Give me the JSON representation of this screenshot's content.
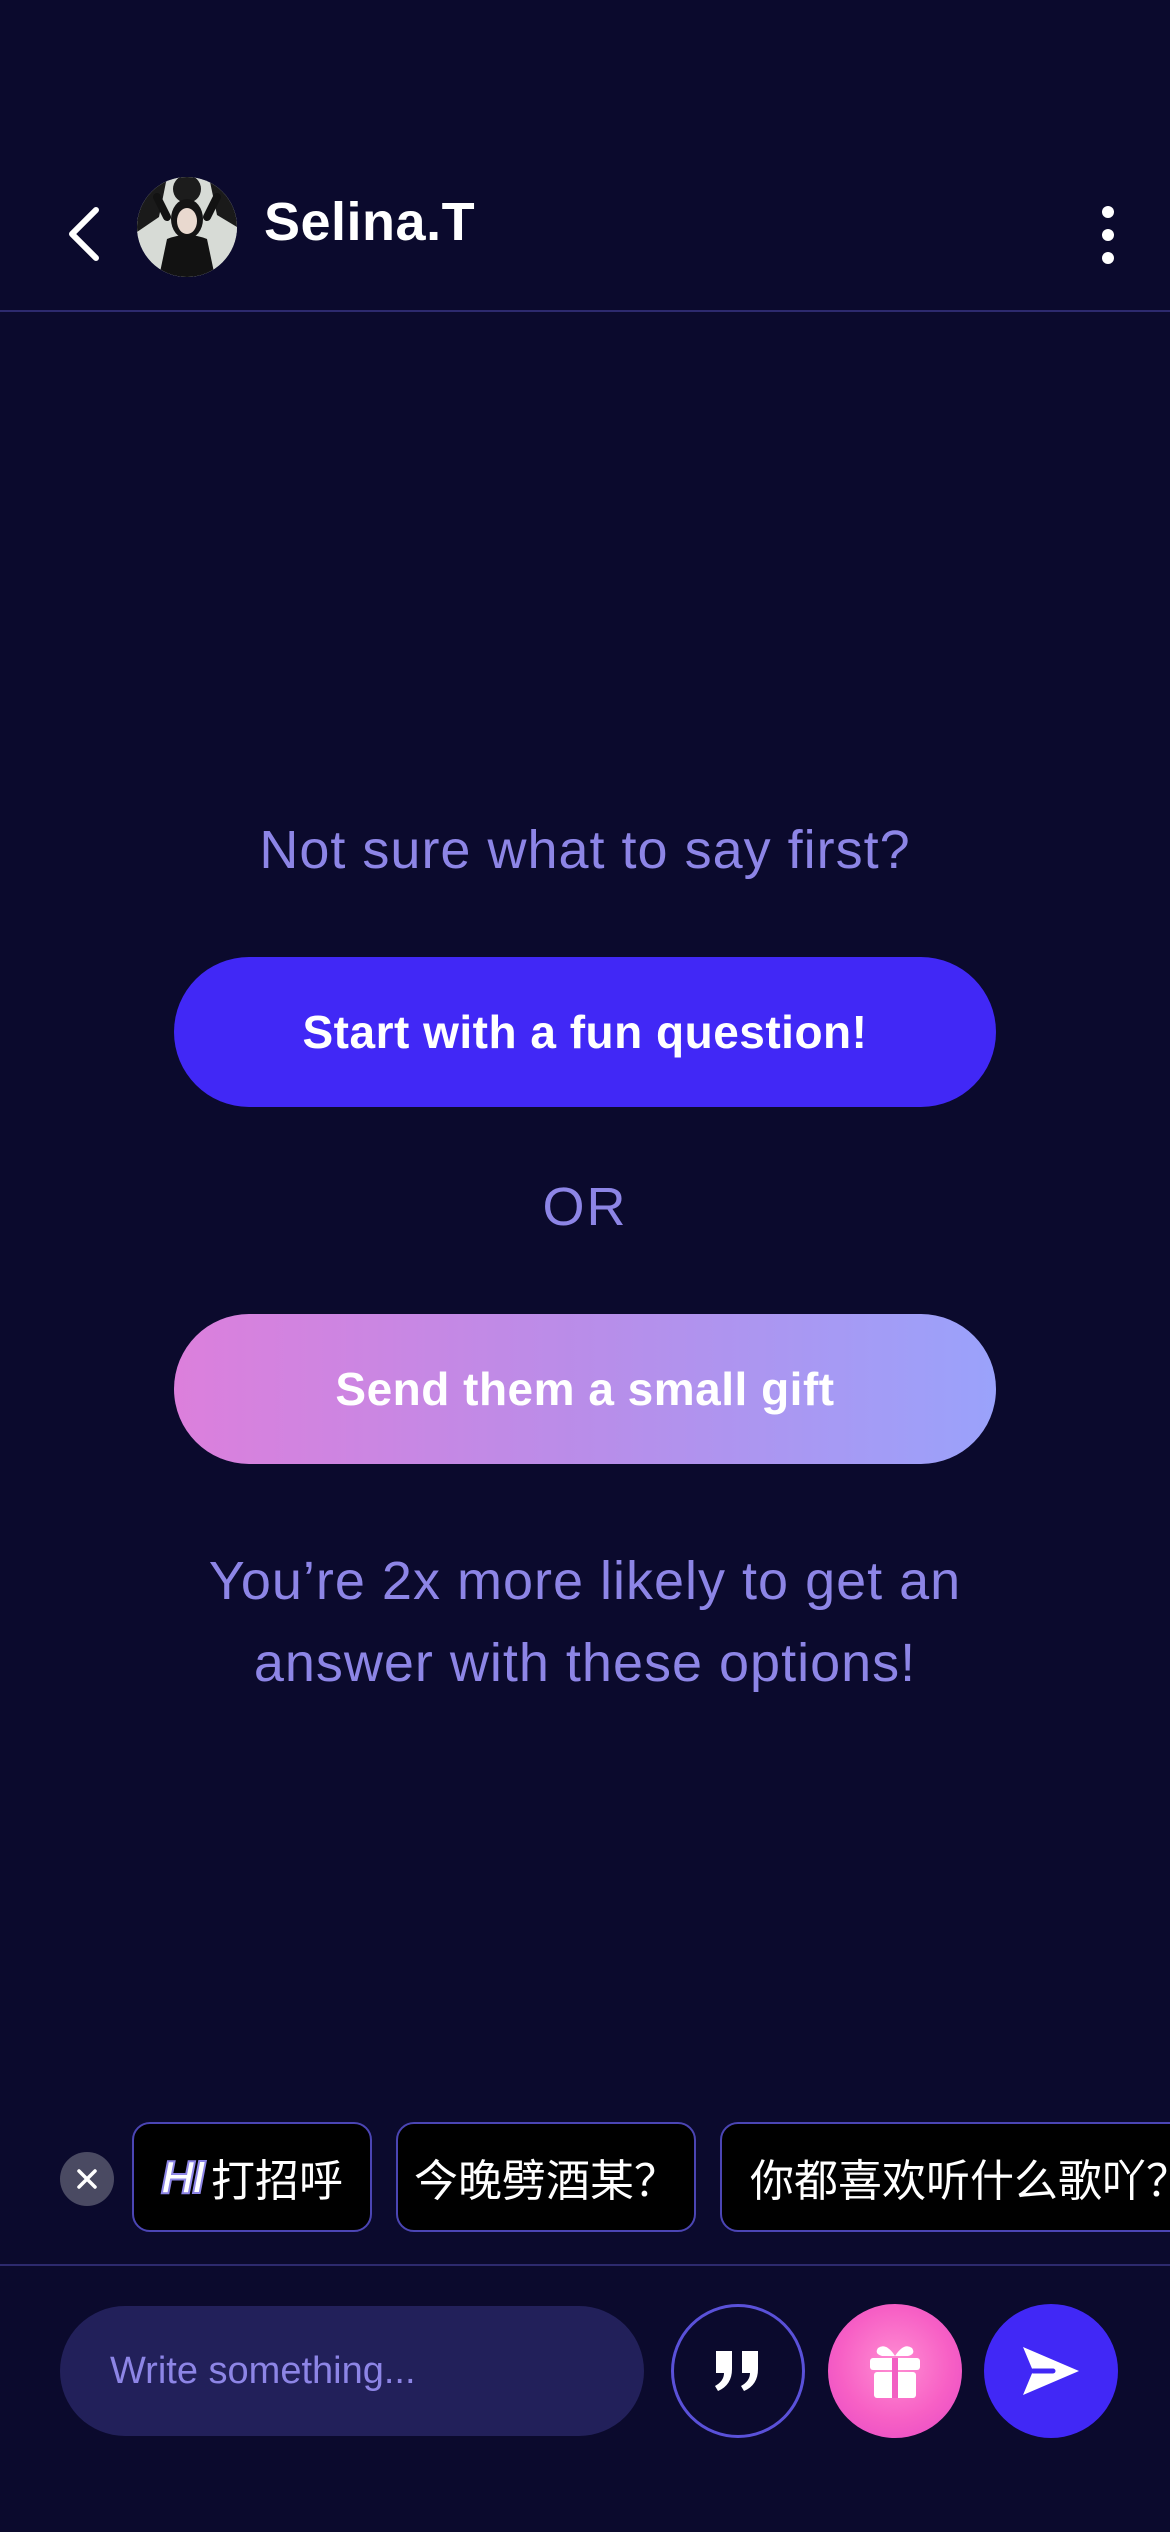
{
  "header": {
    "user_name": "Selina.T",
    "back_icon": "chevron-left-icon",
    "more_icon": "more-vertical-icon"
  },
  "prompt": {
    "title": "Not sure what to say first?",
    "question_button": "Start with a fun question!",
    "or_label": "OR",
    "gift_button": "Send them a small gift",
    "hint": "You’re 2x more likely to get an answer with these options!"
  },
  "quick_replies": {
    "hi_badge": "HI",
    "items": [
      "打招呼",
      "今晚劈酒某？",
      "你都喜欢听什么歌吖？"
    ]
  },
  "composer": {
    "placeholder": "Write something...",
    "quote_icon": "quote-icon",
    "gift_icon": "gift-icon",
    "send_icon": "send-icon"
  },
  "colors": {
    "background": "#0b0a2d",
    "accent": "#4128f6",
    "muted_text": "#8d85e6",
    "gift_gradient_start": "#dc7fdc",
    "gift_gradient_end": "#9aa2fb"
  }
}
